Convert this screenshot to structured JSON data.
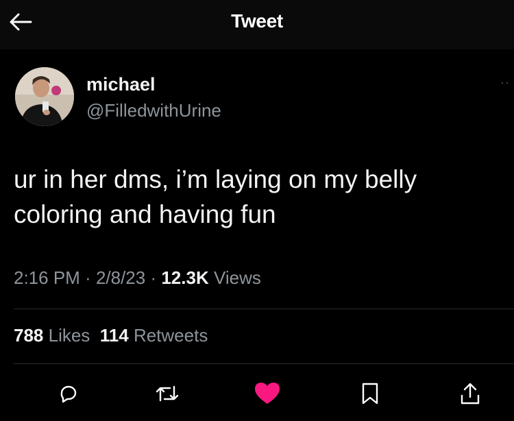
{
  "header": {
    "title": "Tweet",
    "back_icon": "arrow-left-icon"
  },
  "author": {
    "display_name": "michael",
    "handle": "@FilledwithUrine"
  },
  "tweet": {
    "text_line1": "ur in her dms, i’m laying on my belly",
    "text_line2": "coloring and having fun"
  },
  "meta": {
    "time": "2:16 PM",
    "sep1": " · ",
    "date": "2/8/23",
    "sep2": " · ",
    "views_count": "12.3K",
    "views_label": " Views"
  },
  "stats": {
    "likes_count": "788",
    "likes_label": " Likes",
    "retweets_count": "114",
    "retweets_label": " Retweets"
  },
  "actions": [
    {
      "icon": "reply-icon"
    },
    {
      "icon": "retweet-icon"
    },
    {
      "icon": "heart-icon",
      "active": true,
      "color": "#f91880"
    },
    {
      "icon": "bookmark-icon"
    },
    {
      "icon": "share-icon"
    }
  ],
  "colors": {
    "background": "#000000",
    "secondary_text": "#8e959b",
    "like_active": "#f91880"
  }
}
